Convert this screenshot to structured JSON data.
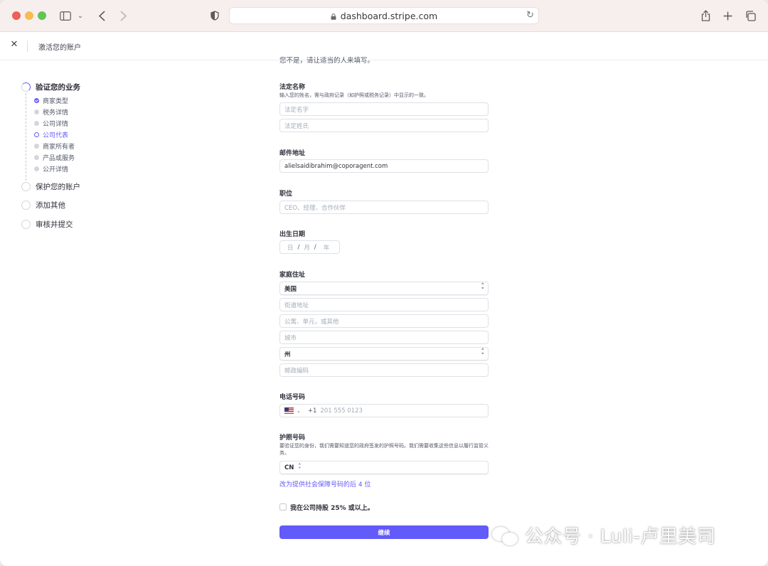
{
  "browser": {
    "url": "dashboard.stripe.com"
  },
  "header": {
    "close_label": "✕",
    "title": "激活您的账户"
  },
  "sidebar": {
    "steps": [
      {
        "label": "验证您的业务"
      },
      {
        "label": "保护您的账户"
      },
      {
        "label": "添加其他"
      },
      {
        "label": "审核并提交"
      }
    ],
    "substeps": [
      {
        "label": "商家类型",
        "state": "done"
      },
      {
        "label": "税务详情",
        "state": "todo"
      },
      {
        "label": "公司详情",
        "state": "todo"
      },
      {
        "label": "公司代表",
        "state": "current"
      },
      {
        "label": "商家所有者",
        "state": "todo"
      },
      {
        "label": "产品或服务",
        "state": "todo"
      },
      {
        "label": "公开详情",
        "state": "todo"
      }
    ]
  },
  "form": {
    "cutoff_text": "您不是，请让适当的人来填写。",
    "legal_name": {
      "label": "法定名称",
      "hint": "输入您的姓名，需与政府记录（如护照或税务记录）中显示的一致。",
      "first_placeholder": "法定名字",
      "last_placeholder": "法定姓氏"
    },
    "email": {
      "label": "邮件地址",
      "value": "alielsaidibrahim@coporagent.com"
    },
    "title": {
      "label": "职位",
      "placeholder": "CEO、经理、合作伙伴"
    },
    "dob": {
      "label": "出生日期",
      "day": "日",
      "sep1": "/",
      "month": "月",
      "sep2": "/",
      "year": "年"
    },
    "address": {
      "label": "家庭住址",
      "country": "美国",
      "street_placeholder": "街道地址",
      "unit_placeholder": "公寓、单元，或其他",
      "city_placeholder": "城市",
      "state": "州",
      "zip_placeholder": "邮政编码"
    },
    "phone": {
      "label": "电话号码",
      "code": "+1",
      "placeholder": "201 555 0123"
    },
    "passport": {
      "label": "护照号码",
      "hint": "要验证您的身份，我们需要知道您的政府签发的护照号码。我们需要收集这些信息以履行监管义务。",
      "country": "CN",
      "alt_link": "改为提供社会保障号码的后 4 位"
    },
    "ownership_checkbox": "我在公司持股 25% 或以上。",
    "continue_button": "继续"
  },
  "watermark": {
    "text": "公众号 · Luli-卢里美司"
  },
  "colors": {
    "accent": "#625afa"
  }
}
